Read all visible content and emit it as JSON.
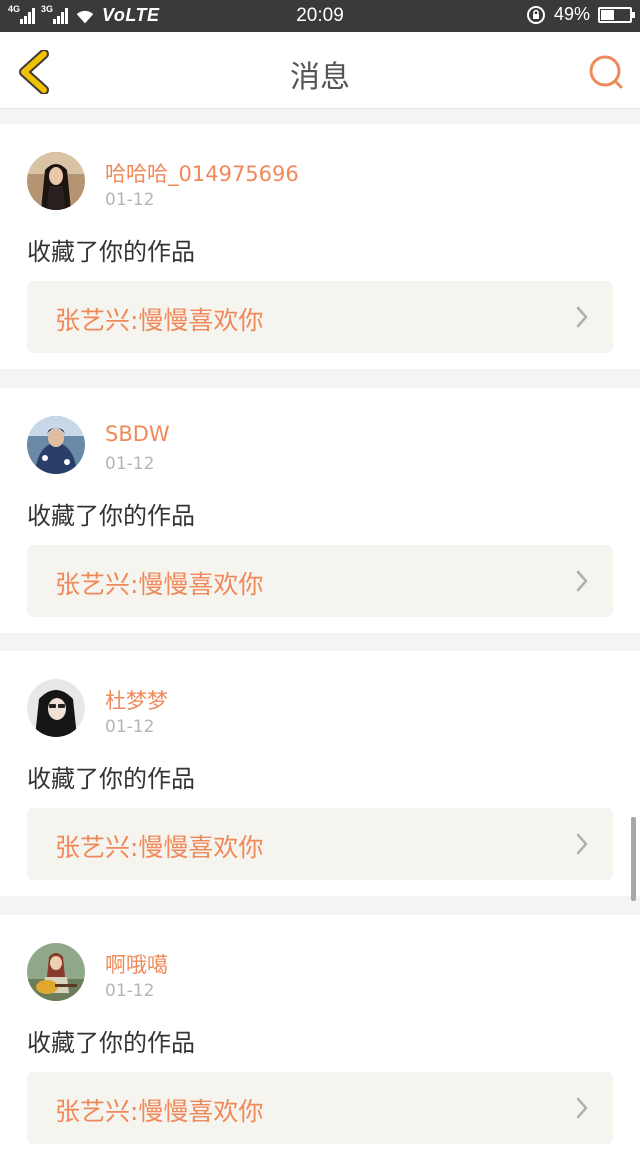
{
  "status_bar": {
    "net1": "4G",
    "net2": "3G",
    "volte": "VoLTE",
    "time": "20:09",
    "battery": "49%",
    "battery_level": 0.49
  },
  "header": {
    "title": "消息"
  },
  "messages": [
    {
      "username": "哈哈哈_014975696",
      "date": "01-12",
      "action": "收藏了你的作品",
      "work_title": "张艺兴:慢慢喜欢你"
    },
    {
      "username": "SBDW",
      "date": "01-12",
      "action": "收藏了你的作品",
      "work_title": "张艺兴:慢慢喜欢你"
    },
    {
      "username": "杜梦梦",
      "date": "01-12",
      "action": "收藏了你的作品",
      "work_title": "张艺兴:慢慢喜欢你"
    },
    {
      "username": "啊哦噶",
      "date": "01-12",
      "action": "收藏了你的作品",
      "work_title": "张艺兴:慢慢喜欢你"
    }
  ],
  "colors": {
    "accent": "#f0895a",
    "back_icon": "#f2c200",
    "header_bg": "#ffffff",
    "work_bg": "#f5f4ef"
  }
}
